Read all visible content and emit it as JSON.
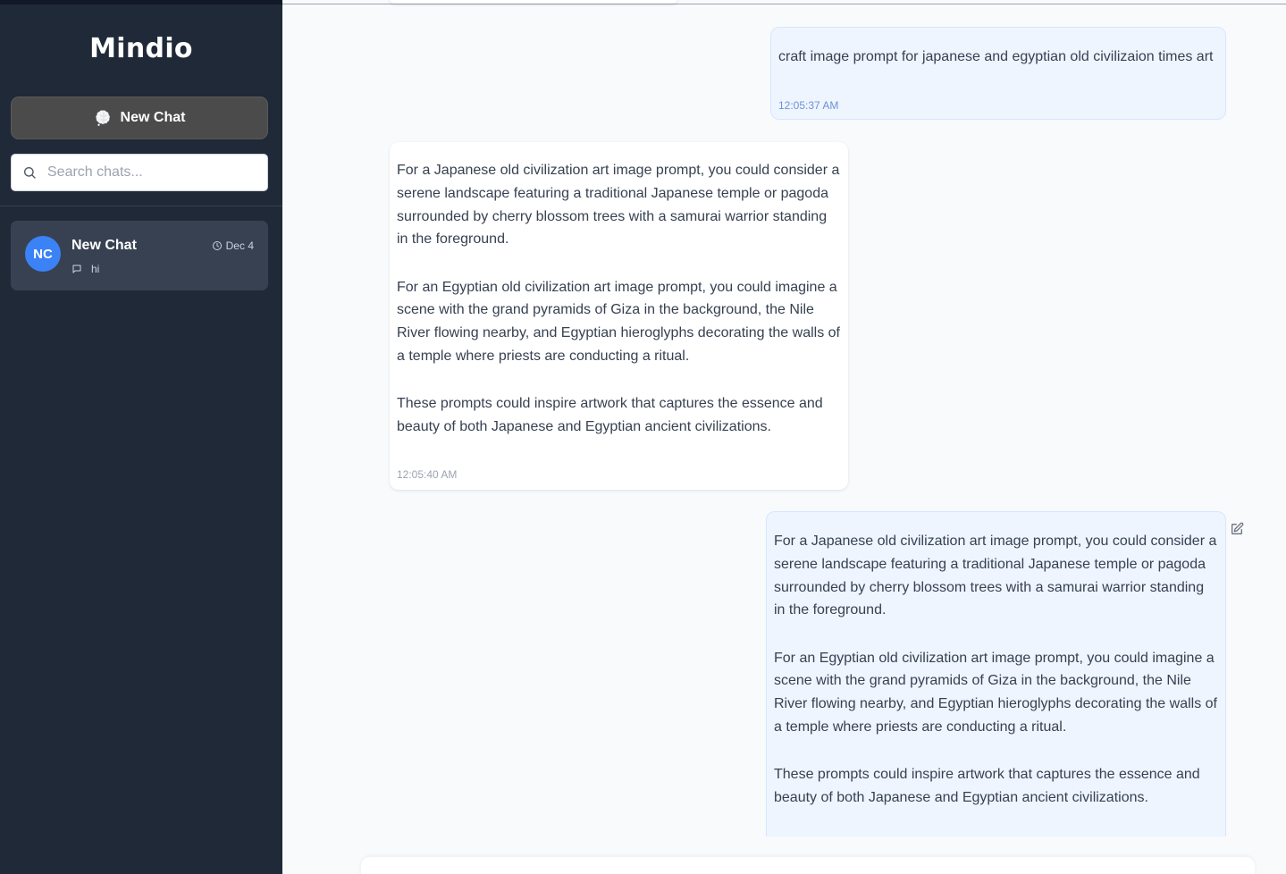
{
  "sidebar": {
    "brand": "Mindio",
    "new_chat_label": "New Chat",
    "search_placeholder": "Search chats...",
    "chats": [
      {
        "initials": "NC",
        "title": "New Chat",
        "date": "Dec 4",
        "preview": "hi"
      }
    ]
  },
  "colors": {
    "sidebar_bg": "#1f2937",
    "accent": "#3b82f6",
    "user_bubble": "#eef5ff"
  },
  "icons": {
    "new_chat": "brain-icon",
    "search": "search-icon",
    "date": "clock-icon",
    "preview": "message-icon",
    "collapse": "chevrons-left-icon",
    "edit": "edit-icon"
  },
  "conversation": {
    "messages": [
      {
        "role": "user",
        "paragraphs": [
          "craft image prompt for japanese and egyptian old civilizaion times art"
        ],
        "time": "12:05:37 AM"
      },
      {
        "role": "assistant",
        "paragraphs": [
          "For a Japanese old civilization art image prompt, you could consider a serene landscape featuring a traditional Japanese temple or pagoda surrounded by cherry blossom trees with a samurai warrior standing in the foreground.",
          "For an Egyptian old civilization art image prompt, you could imagine a scene with the grand pyramids of Giza in the background, the Nile River flowing nearby, and Egyptian hieroglyphs decorating the walls of a temple where priests are conducting a ritual.",
          "These prompts could inspire artwork that captures the essence and beauty of both Japanese and Egyptian ancient civilizations."
        ],
        "time": "12:05:40 AM"
      },
      {
        "role": "user",
        "paragraphs": [
          "For a Japanese old civilization art image prompt, you could consider a serene landscape featuring a traditional Japanese temple or pagoda surrounded by cherry blossom trees with a samurai warrior standing in the foreground.",
          "For an Egyptian old civilization art image prompt, you could imagine a scene with the grand pyramids of Giza in the background, the Nile River flowing nearby, and Egyptian hieroglyphs decorating the walls of a temple where priests are conducting a ritual.",
          "These prompts could inspire artwork that captures the essence and beauty of both Japanese and Egyptian ancient civilizations."
        ]
      }
    ]
  }
}
